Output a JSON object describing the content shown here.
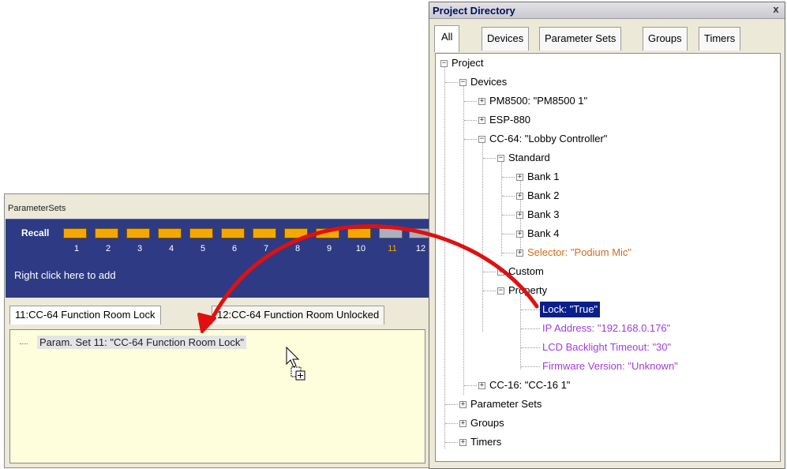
{
  "parameter_sets": {
    "title": "ParameterSets",
    "recall_label": "Recall",
    "recall_numbers": [
      "1",
      "2",
      "3",
      "4",
      "5",
      "6",
      "7",
      "8",
      "9",
      "10",
      "11",
      "12"
    ],
    "add_hint": "Right click here to add",
    "tabs": [
      "11:CC-64 Function Room Lock",
      "12:CC-64 Function Room Unlocked"
    ],
    "content_item": "Param. Set 11: \"CC-64 Function Room Lock\""
  },
  "project_directory": {
    "title": "Project Directory",
    "close_label": "x",
    "tabs": [
      "All",
      "Devices",
      "Parameter Sets",
      "Groups",
      "Timers"
    ],
    "tree": {
      "project": "Project",
      "devices": "Devices",
      "pm8500": "PM8500: \"PM8500 1\"",
      "esp880": "ESP-880",
      "cc64": "CC-64: \"Lobby Controller\"",
      "standard": "Standard",
      "bank1": "Bank 1",
      "bank2": "Bank 2",
      "bank3": "Bank 3",
      "bank4": "Bank 4",
      "selector": "Selector: \"Podium Mic\"",
      "custom": "Custom",
      "property": "Property",
      "lock": "Lock: \"True\"",
      "ip": "IP Address: \"192.168.0.176\"",
      "lcd": "LCD Backlight Timeout: \"30\"",
      "firmware": "Firmware Version: \"Unknown\"",
      "cc16": "CC-16: \"CC-16 1\"",
      "param_sets": "Parameter Sets",
      "groups": "Groups",
      "timers": "Timers"
    }
  },
  "colors": {
    "panel_blue": "#2e3a84",
    "recall_button": "#f6a800",
    "selection": "#0a1f8a",
    "drag_arrow": "#e01010",
    "orange_text": "#d46a1e",
    "purple_text": "#a03ce0"
  },
  "icons": {
    "cursor": "arrow-cursor-icon",
    "copy_badge": "copy-plus-icon",
    "expand": "plus-box-icon",
    "collapse": "minus-box-icon"
  }
}
